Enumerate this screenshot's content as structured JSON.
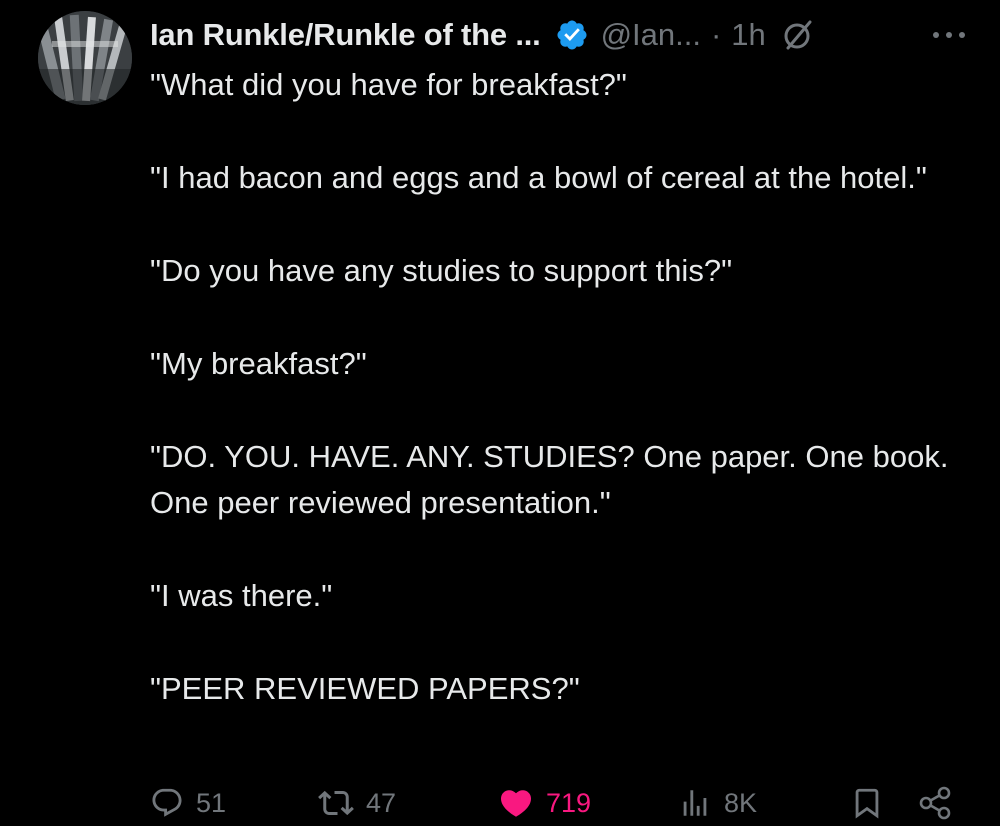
{
  "tweet": {
    "author": {
      "display_name": "Ian Runkle/Runkle of the ...",
      "handle": "@Ian...",
      "separator": "·",
      "time": "1h",
      "verified": true,
      "avatar_icon": "avatar-photo"
    },
    "body": [
      "\"What did you have for breakfast?\"",
      "\"I had bacon and eggs and a bowl of cereal at the hotel.\"",
      "\"Do you have any studies to support this?\"",
      "\"My breakfast?\"",
      "\"DO. YOU. HAVE. ANY. STUDIES? One paper. One book. One peer reviewed presentation.\"",
      "\"I was there.\"",
      "\"PEER REVIEWED PAPERS?\""
    ],
    "stats": {
      "replies": "51",
      "retweets": "47",
      "likes": "719",
      "views": "8K"
    },
    "liked": true
  },
  "icons": {
    "verified": "verified-badge-icon",
    "grok": "grok-icon",
    "more": "more-options-icon",
    "reply": "reply-icon",
    "retweet": "retweet-icon",
    "like": "heart-icon",
    "views": "views-icon",
    "bookmark": "bookmark-icon",
    "share": "share-icon"
  },
  "colors": {
    "background": "#000000",
    "text_primary": "#e7e9ea",
    "text_secondary": "#71767b",
    "verified_blue": "#1d9bf0",
    "like_pink": "#f91880"
  }
}
